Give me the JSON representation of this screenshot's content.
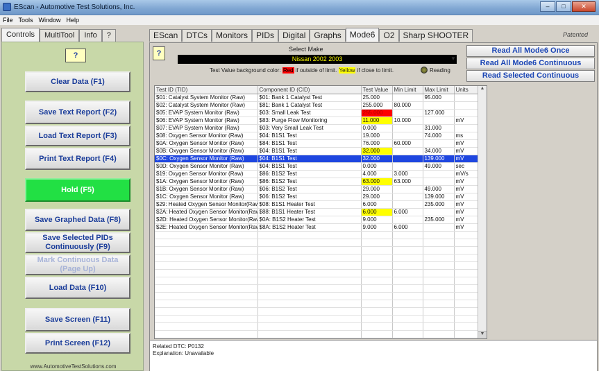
{
  "window": {
    "title": "EScan - Automotive Test Solutions, Inc."
  },
  "menu": [
    "File",
    "Tools",
    "Window",
    "Help"
  ],
  "left_tabs": [
    "Controls",
    "MultiTool",
    "Info",
    "?"
  ],
  "left_help": "?",
  "left_buttons": {
    "clear": "Clear Data (F1)",
    "save_text": "Save Text Report (F2)",
    "load_text": "Load Text Report (F3)",
    "print_text": "Print Text Report (F4)",
    "hold": "Hold (F5)",
    "save_graphed": "Save Graphed Data (F8)",
    "save_selected": "Save Selected PIDs Continuously (F9)",
    "mark_continuous": "Mark Continuous Data (Page Up)",
    "load_data": "Load Data (F10)",
    "save_screen": "Save Screen (F11)",
    "print_screen": "Print Screen (F12)"
  },
  "website": "www.AutomotiveTestSolutions.com",
  "right_tabs": [
    "EScan",
    "DTCs",
    "Monitors",
    "PIDs",
    "Digital",
    "Graphs",
    "Mode6",
    "O2",
    "Sharp SHOOTER"
  ],
  "patented": "Patented",
  "right_help": "?",
  "select_make": {
    "label": "Select Make",
    "value": "Nissan 2002 2003"
  },
  "legend": {
    "prefix": "Test Value background color:",
    "red": "Red",
    "mid": "if outside of limit.",
    "yellow": "Yellow",
    "suffix": "if close to limit."
  },
  "reading": "Reading",
  "mode6_buttons": {
    "read_once": "Read All Mode6 Once",
    "read_continuous": "Read All Mode6 Continuous",
    "read_selected": "Read Selected Continuous"
  },
  "table": {
    "columns": [
      "Test ID (TID)",
      "Component ID (CID)",
      "Test Value",
      "Min Limit",
      "Max Limit",
      "Units"
    ],
    "rows": [
      {
        "tid": "$01: Catalyst System Monitor (Raw)",
        "cid": "$01: Bank 1 Catalyst Test",
        "value": "25.000",
        "min": "",
        "max": "95.000",
        "units": "",
        "flag": ""
      },
      {
        "tid": "$02: Catalyst System Monitor (Raw)",
        "cid": "$81: Bank 1 Catalyst Test",
        "value": "255.000",
        "min": "80.000",
        "max": "",
        "units": "",
        "flag": ""
      },
      {
        "tid": "$05: EVAP System Monitor (Raw)",
        "cid": "$03: Small Leak Test",
        "value": "255.000",
        "min": "",
        "max": "127.000",
        "units": "",
        "flag": "red"
      },
      {
        "tid": "$06: EVAP System Monitor (Raw)",
        "cid": "$83: Purge Flow Monitoring",
        "value": "11.000",
        "min": "10.000",
        "max": "",
        "units": "mV",
        "flag": "yellow"
      },
      {
        "tid": "$07: EVAP System Monitor (Raw)",
        "cid": "$03: Very Small Leak Test",
        "value": "0.000",
        "min": "",
        "max": "31.000",
        "units": "",
        "flag": ""
      },
      {
        "tid": "$08: Oxygen Sensor Monitor (Raw)",
        "cid": "$04: B1S1 Test",
        "value": "19.000",
        "min": "",
        "max": "74.000",
        "units": "ms",
        "flag": ""
      },
      {
        "tid": "$0A: Oxygen Sensor Monitor (Raw)",
        "cid": "$84: B1S1 Test",
        "value": "76.000",
        "min": "60.000",
        "max": "",
        "units": "mV",
        "flag": ""
      },
      {
        "tid": "$0B: Oxygen Sensor Monitor (Raw)",
        "cid": "$04: B1S1 Test",
        "value": "32.000",
        "min": "",
        "max": "34.000",
        "units": "mV",
        "flag": "yellow"
      },
      {
        "tid": "$0C: Oxygen Sensor Monitor (Raw)",
        "cid": "$04: B1S1 Test",
        "value": "32.000",
        "min": "",
        "max": "139.000",
        "units": "mV",
        "flag": "selected"
      },
      {
        "tid": "$0D: Oxygen Sensor Monitor (Raw)",
        "cid": "$04: B1S1 Test",
        "value": "0.000",
        "min": "",
        "max": "49.000",
        "units": "sec",
        "flag": ""
      },
      {
        "tid": "$19: Oxygen Sensor Monitor (Raw)",
        "cid": "$86: B1S2 Test",
        "value": "4.000",
        "min": "3.000",
        "max": "",
        "units": "mV/s",
        "flag": ""
      },
      {
        "tid": "$1A: Oxygen Sensor Monitor (Raw)",
        "cid": "$86: B1S2 Test",
        "value": "63.000",
        "min": "63.000",
        "max": "",
        "units": "mV",
        "flag": "yellow"
      },
      {
        "tid": "$1B: Oxygen Sensor Monitor (Raw)",
        "cid": "$06: B1S2 Test",
        "value": "29.000",
        "min": "",
        "max": "49.000",
        "units": "mV",
        "flag": ""
      },
      {
        "tid": "$1C: Oxygen Sensor Monitor (Raw)",
        "cid": "$06: B1S2 Test",
        "value": "29.000",
        "min": "",
        "max": "139.000",
        "units": "mV",
        "flag": ""
      },
      {
        "tid": "$29: Heated Oxygen Sensor Monitor(Raw)",
        "cid": "$08: B1S1 Heater Test",
        "value": "6.000",
        "min": "",
        "max": "235.000",
        "units": "mV",
        "flag": ""
      },
      {
        "tid": "$2A: Heated Oxygen Sensor Monitor(Raw)",
        "cid": "$88: B1S1 Heater Test",
        "value": "6.000",
        "min": "6.000",
        "max": "",
        "units": "mV",
        "flag": "yellow"
      },
      {
        "tid": "$2D: Heated Oxygen Sensor Monitor(Raw)",
        "cid": "$0A: B1S2 Heater Test",
        "value": "9.000",
        "min": "",
        "max": "235.000",
        "units": "mV",
        "flag": ""
      },
      {
        "tid": "$2E: Heated Oxygen Sensor Monitor(Raw)",
        "cid": "$8A: B1S2 Heater Test",
        "value": "9.000",
        "min": "6.000",
        "max": "",
        "units": "mV",
        "flag": ""
      }
    ],
    "empty_rows": 14
  },
  "info": {
    "related_dtc": "Related DTC: P0132",
    "explanation": "Explanation: Unavailable"
  }
}
